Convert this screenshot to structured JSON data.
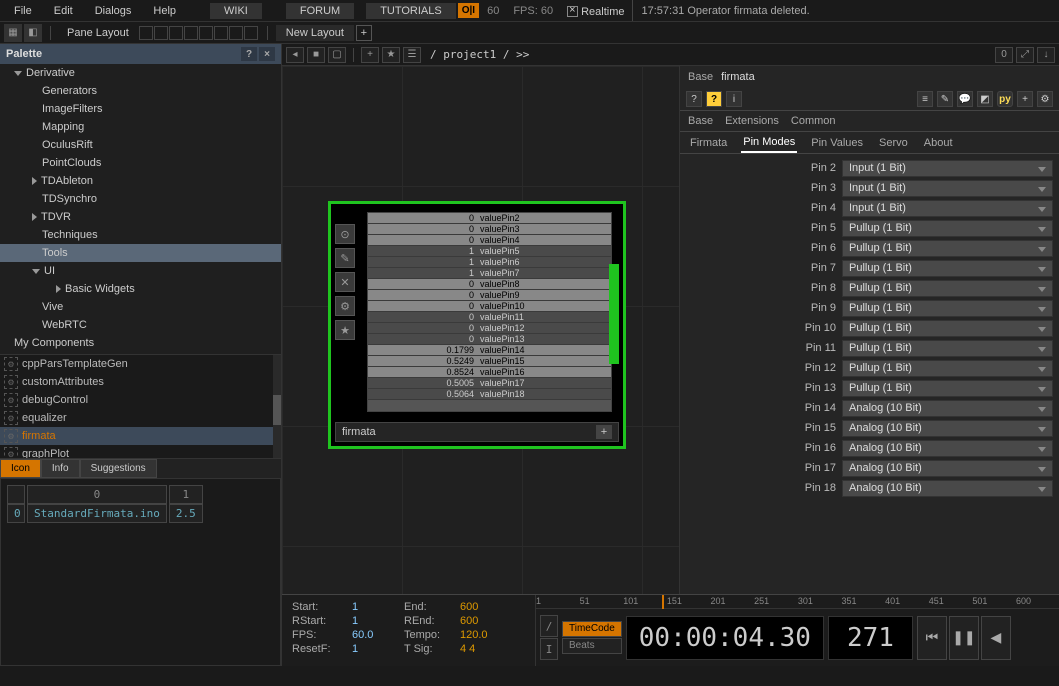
{
  "menubar": {
    "items": [
      "File",
      "Edit",
      "Dialogs",
      "Help"
    ],
    "links": {
      "wiki": "WIKI",
      "forum": "FORUM",
      "tutorials": "TUTORIALS"
    },
    "badge": "O|I",
    "badge_num": "60",
    "fps": "FPS:  60",
    "realtime": "Realtime",
    "status": "17:57:31 Operator firmata deleted."
  },
  "toolbar": {
    "pane_layout": "Pane Layout",
    "new_layout": "New Layout"
  },
  "palette": {
    "title": "Palette",
    "tree": [
      {
        "lvl": 1,
        "arrow": "down",
        "label": "Derivative"
      },
      {
        "lvl": 3,
        "label": "Generators"
      },
      {
        "lvl": 3,
        "label": "ImageFilters"
      },
      {
        "lvl": 3,
        "label": "Mapping"
      },
      {
        "lvl": 3,
        "label": "OculusRift"
      },
      {
        "lvl": 3,
        "label": "PointClouds"
      },
      {
        "lvl": 2,
        "arrow": "right",
        "label": "TDAbleton"
      },
      {
        "lvl": 3,
        "label": "TDSynchro"
      },
      {
        "lvl": 2,
        "arrow": "right",
        "label": "TDVR"
      },
      {
        "lvl": 3,
        "label": "Techniques"
      },
      {
        "lvl": 3,
        "label": "Tools",
        "sel": true
      },
      {
        "lvl": 2,
        "arrow": "down",
        "label": "UI"
      },
      {
        "lvl": 4,
        "arrow": "right",
        "label": "Basic Widgets"
      },
      {
        "lvl": 3,
        "label": "Vive"
      },
      {
        "lvl": 3,
        "label": "WebRTC"
      },
      {
        "lvl": 1,
        "label": "My Components"
      }
    ],
    "comps": [
      {
        "label": "cppParsTemplateGen"
      },
      {
        "label": "customAttributes"
      },
      {
        "label": "debugControl"
      },
      {
        "label": "equalizer"
      },
      {
        "label": "firmata",
        "active": true
      },
      {
        "label": "graphPlot"
      }
    ],
    "preview": {
      "tabs": [
        "Icon",
        "Info",
        "Suggestions"
      ],
      "cols": [
        "0",
        "1"
      ],
      "row_idx": "0",
      "file": "StandardFirmata.ino",
      "ver": "2.5"
    }
  },
  "center": {
    "path": "/ project1 / >>",
    "top_right": [
      "0"
    ]
  },
  "node": {
    "name": "firmata",
    "side_icons": [
      "⊙",
      "✎",
      "✕",
      "⚙",
      "★"
    ],
    "pins": [
      {
        "v": "0",
        "n": "valuePin2",
        "grp": 0
      },
      {
        "v": "0",
        "n": "valuePin3",
        "grp": 0
      },
      {
        "v": "0",
        "n": "valuePin4",
        "grp": 0
      },
      {
        "v": "1",
        "n": "valuePin5"
      },
      {
        "v": "1",
        "n": "valuePin6"
      },
      {
        "v": "1",
        "n": "valuePin7"
      },
      {
        "v": "0",
        "n": "valuePin8",
        "grp": 0
      },
      {
        "v": "0",
        "n": "valuePin9",
        "grp": 0
      },
      {
        "v": "0",
        "n": "valuePin10",
        "grp": 0
      },
      {
        "v": "0",
        "n": "valuePin11"
      },
      {
        "v": "0",
        "n": "valuePin12"
      },
      {
        "v": "0",
        "n": "valuePin13"
      },
      {
        "v": "0.1799",
        "n": "valuePin14",
        "grp": 0
      },
      {
        "v": "0.5249",
        "n": "valuePin15",
        "grp": 0
      },
      {
        "v": "0.8524",
        "n": "valuePin16",
        "sel": true,
        "grp": 0
      },
      {
        "v": "0.5005",
        "n": "valuePin17"
      },
      {
        "v": "0.5064",
        "n": "valuePin18"
      }
    ]
  },
  "params": {
    "kind": "Base",
    "name": "firmata",
    "tabrow1": [
      "Base",
      "Extensions",
      "Common"
    ],
    "tabrow2": [
      "Firmata",
      "Pin Modes",
      "Pin Values",
      "Servo",
      "About"
    ],
    "active_tab": "Pin Modes",
    "rows": [
      {
        "label": "Pin 2",
        "value": "Input (1 Bit)"
      },
      {
        "label": "Pin 3",
        "value": "Input (1 Bit)"
      },
      {
        "label": "Pin 4",
        "value": "Input (1 Bit)"
      },
      {
        "label": "Pin 5",
        "value": "Pullup (1 Bit)"
      },
      {
        "label": "Pin 6",
        "value": "Pullup (1 Bit)"
      },
      {
        "label": "Pin 7",
        "value": "Pullup (1 Bit)"
      },
      {
        "label": "Pin 8",
        "value": "Pullup (1 Bit)"
      },
      {
        "label": "Pin 9",
        "value": "Pullup (1 Bit)"
      },
      {
        "label": "Pin 10",
        "value": "Pullup (1 Bit)"
      },
      {
        "label": "Pin 11",
        "value": "Pullup (1 Bit)"
      },
      {
        "label": "Pin 12",
        "value": "Pullup (1 Bit)"
      },
      {
        "label": "Pin 13",
        "value": "Pullup (1 Bit)"
      },
      {
        "label": "Pin 14",
        "value": "Analog (10 Bit)"
      },
      {
        "label": "Pin 15",
        "value": "Analog (10 Bit)"
      },
      {
        "label": "Pin 16",
        "value": "Analog (10 Bit)"
      },
      {
        "label": "Pin 17",
        "value": "Analog (10 Bit)"
      },
      {
        "label": "Pin 18",
        "value": "Analog (10 Bit)"
      }
    ]
  },
  "timeline": {
    "left": [
      {
        "k": "Start:",
        "v": "1",
        "k2": "End:",
        "v2": "600"
      },
      {
        "k": "RStart:",
        "v": "1",
        "k2": "REnd:",
        "v2": "600"
      },
      {
        "k": "FPS:",
        "v": "60.0",
        "k2": "Tempo:",
        "v2": "120.0"
      },
      {
        "k": "ResetF:",
        "v": "1",
        "k2": "T Sig:",
        "v2": "4     4"
      }
    ],
    "ruler_ticks": [
      "1",
      "51",
      "101",
      "151",
      "201",
      "251",
      "301",
      "351",
      "401",
      "451",
      "501",
      "600"
    ],
    "modes": {
      "a": "TimeCode",
      "b": "Beats"
    },
    "time": "00:00:04.30",
    "frame": "271",
    "flags": [
      "/",
      "I"
    ]
  }
}
